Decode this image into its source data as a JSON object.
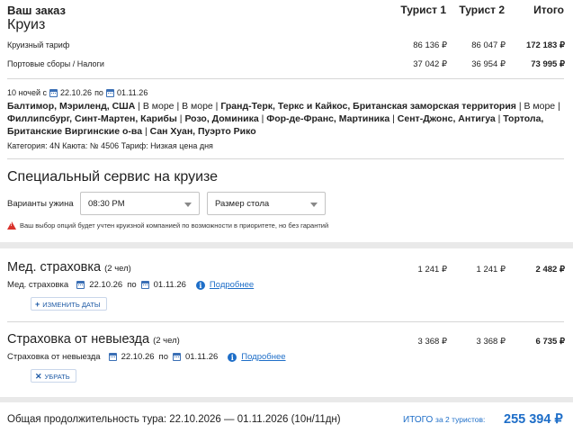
{
  "header": {
    "title": "Ваш заказ",
    "cols": [
      "Турист 1",
      "Турист 2",
      "Итого"
    ]
  },
  "cruise": {
    "title": "Круиз",
    "rows": [
      {
        "label": "Круизный тариф",
        "t1": "86 136 ₽",
        "t2": "86 047 ₽",
        "total": "172 183 ₽"
      },
      {
        "label": "Портовые сборы / Налоги",
        "t1": "37 042 ₽",
        "t2": "36 954 ₽",
        "total": "73 995 ₽"
      }
    ],
    "nights": "10 ночей с",
    "date_from": "22.10.26",
    "date_to_prefix": "по",
    "date_to": "01.11.26",
    "route": [
      {
        "text": "Балтимор, Мэриленд, США",
        "bold": true
      },
      {
        "text": "В море",
        "bold": false
      },
      {
        "text": "В море",
        "bold": false
      },
      {
        "text": "Гранд-Терк, Теркс и Кайкос, Британская заморская территория",
        "bold": true
      },
      {
        "text": "В море",
        "bold": false
      },
      {
        "text": "Филлипсбург, Синт-Мартен, Карибы",
        "bold": true
      },
      {
        "text": "Розо, Доминика",
        "bold": true
      },
      {
        "text": "Фор-де-Франс, Мартиника",
        "bold": true
      },
      {
        "text": "Сент-Джонс, Антигуа",
        "bold": true
      },
      {
        "text": "Тортола, Британские Виргинские о-ва",
        "bold": true
      },
      {
        "text": "Сан Хуан, Пуэрто Рико",
        "bold": true
      }
    ],
    "details": "Категория: 4N  Каюта: № 4506  Тариф: Низкая цена дня"
  },
  "service": {
    "title": "Специальный сервис на круизе",
    "dinner_label": "Варианты ужина",
    "dinner_value": "08:30 PM",
    "table_size_value": "Размер стола",
    "warning": "Ваш выбор опций будет учтен круизной компанией по возможности в приоритете, но без гарантий"
  },
  "insurance": [
    {
      "title": "Мед. страховка",
      "count": "(2 чел)",
      "t1": "1 241 ₽",
      "t2": "1 241 ₽",
      "total": "2 482 ₽",
      "sub_label": "Мед. страховка",
      "date_from": "22.10.26",
      "date_to_prefix": "по",
      "date_to": "01.11.26",
      "more": "Подробнее",
      "button_glyph": "+",
      "button": "ИЗМЕНИТЬ ДАТЫ"
    },
    {
      "title": "Страховка от невыезда",
      "count": "(2 чел)",
      "t1": "3 368 ₽",
      "t2": "3 368 ₽",
      "total": "6 735 ₽",
      "sub_label": "Страховка от невыезда",
      "date_from": "22.10.26",
      "date_to_prefix": "по",
      "date_to": "01.11.26",
      "more": "Подробнее",
      "button_glyph": "✕",
      "button": "УБРАТЬ"
    }
  ],
  "footer": {
    "duration": "Общая продолжительность тура: 22.10.2026 — 01.11.2026 (10н/11дн)",
    "total_label": "ИТОГО",
    "total_sub": "за 2 туристов:",
    "total": "255 394 ₽"
  },
  "colors": {
    "accent": "#1e6ec8",
    "warning": "#d9312b"
  }
}
